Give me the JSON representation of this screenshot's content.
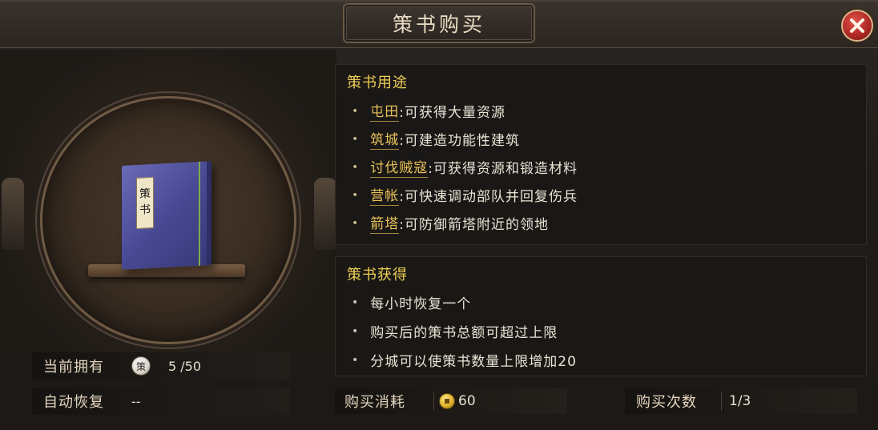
{
  "dialog": {
    "title": "策书购买",
    "close_icon": "close-icon"
  },
  "book": {
    "label_chars": [
      "策",
      "书"
    ]
  },
  "stats": {
    "owned_label": "当前拥有",
    "owned_icon_char": "策",
    "owned_value": "5 /50",
    "recovery_label": "自动恢复",
    "recovery_value": "--"
  },
  "usage": {
    "title": "策书用途",
    "items": [
      {
        "keyword": "屯田",
        "desc": ":可获得大量资源"
      },
      {
        "keyword": "筑城",
        "desc": ":可建造功能性建筑"
      },
      {
        "keyword": "讨伐贼寇",
        "desc": ":可获得资源和锻造材料"
      },
      {
        "keyword": "营帐",
        "desc": ":可快速调动部队并回复伤兵"
      },
      {
        "keyword": "箭塔",
        "desc": ":可防御箭塔附近的领地"
      }
    ]
  },
  "obtain": {
    "title": "策书获得",
    "items": [
      "每小时恢复一个",
      "购买后的策书总额可超过上限",
      "分城可以使策书数量上限增加20"
    ]
  },
  "purchase": {
    "cost_label": "购买消耗",
    "cost_value": "60",
    "count_label": "购买次数",
    "count_value": "1/3"
  },
  "colors": {
    "accent_gold": "#f0cf55",
    "keyword": "#e9c25a",
    "close_red": "#b02a25"
  }
}
